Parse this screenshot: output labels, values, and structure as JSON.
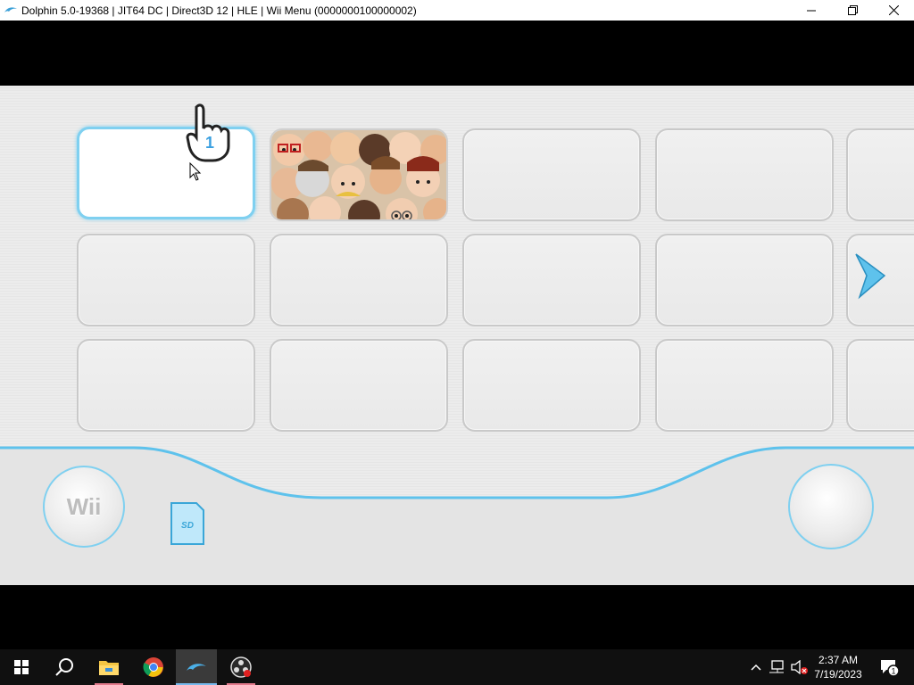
{
  "window": {
    "title": "Dolphin 5.0-19368 | JIT64 DC | Direct3D 12 | HLE | Wii Menu (0000000100000002)",
    "icon": "dolphin-icon",
    "controls": [
      "minimize-icon",
      "maximize-icon",
      "close-icon"
    ]
  },
  "wii_menu": {
    "channels": [
      {
        "name": "disc-channel",
        "state": "selected-empty"
      },
      {
        "name": "mii-channel",
        "state": "mii-faces"
      },
      {
        "name": "empty-channel",
        "state": "empty"
      },
      {
        "name": "empty-channel",
        "state": "empty"
      },
      {
        "name": "empty-channel",
        "state": "empty"
      }
    ],
    "next_page": "chevron-right-icon",
    "pointer": {
      "player": "1"
    },
    "wii_button_label": "Wii",
    "sd_card_label": "SD",
    "accent_color": "#7fd0f0"
  },
  "taskbar": {
    "apps": [
      "windows-start-icon",
      "search-icon",
      "file-explorer-icon",
      "chrome-icon",
      "dolphin-icon",
      "obs-icon"
    ],
    "tray": {
      "time": "2:37 AM",
      "date": "7/19/2023",
      "notification_count": "1"
    }
  }
}
